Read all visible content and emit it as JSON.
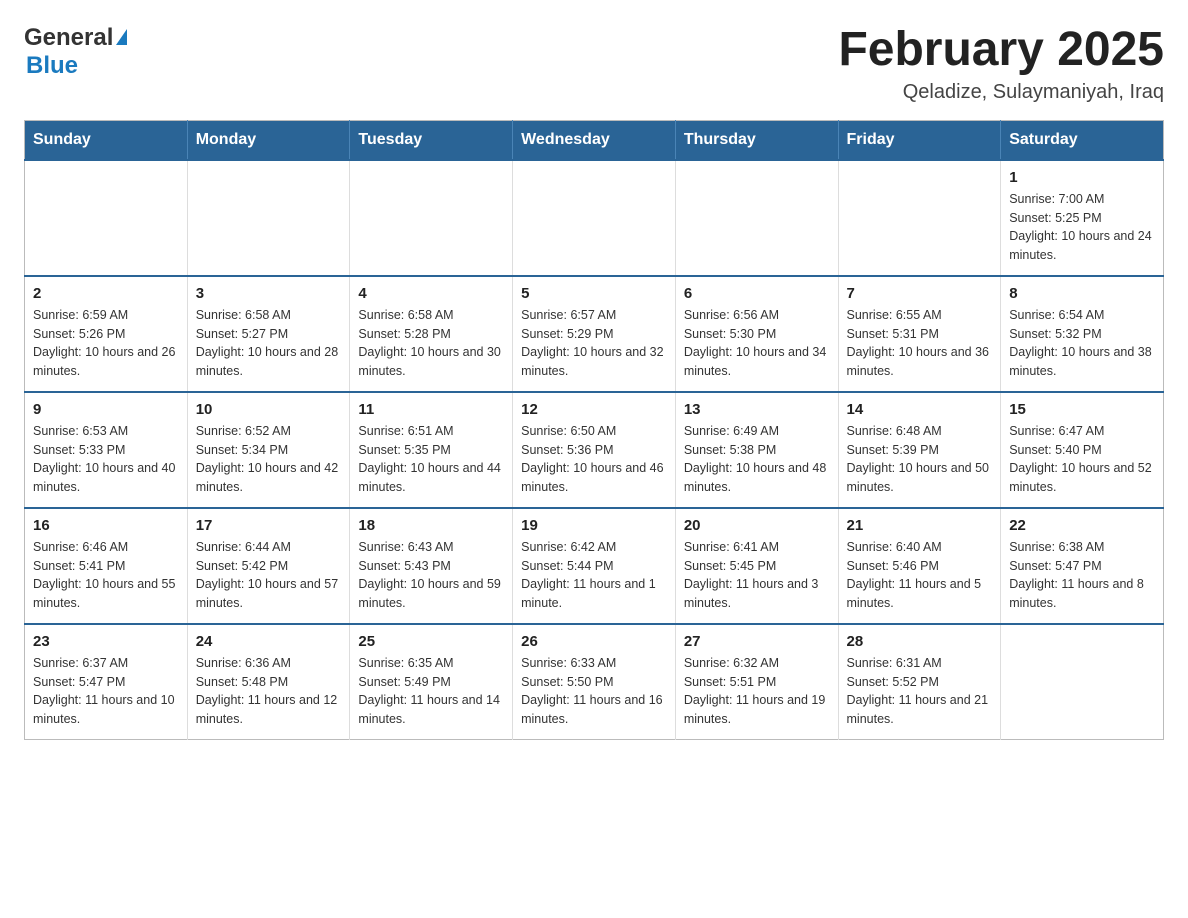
{
  "header": {
    "logo_general": "General",
    "logo_blue": "Blue",
    "title": "February 2025",
    "subtitle": "Qeladize, Sulaymaniyah, Iraq"
  },
  "days_of_week": [
    "Sunday",
    "Monday",
    "Tuesday",
    "Wednesday",
    "Thursday",
    "Friday",
    "Saturday"
  ],
  "weeks": [
    [
      {
        "day": "",
        "sunrise": "",
        "sunset": "",
        "daylight": ""
      },
      {
        "day": "",
        "sunrise": "",
        "sunset": "",
        "daylight": ""
      },
      {
        "day": "",
        "sunrise": "",
        "sunset": "",
        "daylight": ""
      },
      {
        "day": "",
        "sunrise": "",
        "sunset": "",
        "daylight": ""
      },
      {
        "day": "",
        "sunrise": "",
        "sunset": "",
        "daylight": ""
      },
      {
        "day": "",
        "sunrise": "",
        "sunset": "",
        "daylight": ""
      },
      {
        "day": "1",
        "sunrise": "Sunrise: 7:00 AM",
        "sunset": "Sunset: 5:25 PM",
        "daylight": "Daylight: 10 hours and 24 minutes."
      }
    ],
    [
      {
        "day": "2",
        "sunrise": "Sunrise: 6:59 AM",
        "sunset": "Sunset: 5:26 PM",
        "daylight": "Daylight: 10 hours and 26 minutes."
      },
      {
        "day": "3",
        "sunrise": "Sunrise: 6:58 AM",
        "sunset": "Sunset: 5:27 PM",
        "daylight": "Daylight: 10 hours and 28 minutes."
      },
      {
        "day": "4",
        "sunrise": "Sunrise: 6:58 AM",
        "sunset": "Sunset: 5:28 PM",
        "daylight": "Daylight: 10 hours and 30 minutes."
      },
      {
        "day": "5",
        "sunrise": "Sunrise: 6:57 AM",
        "sunset": "Sunset: 5:29 PM",
        "daylight": "Daylight: 10 hours and 32 minutes."
      },
      {
        "day": "6",
        "sunrise": "Sunrise: 6:56 AM",
        "sunset": "Sunset: 5:30 PM",
        "daylight": "Daylight: 10 hours and 34 minutes."
      },
      {
        "day": "7",
        "sunrise": "Sunrise: 6:55 AM",
        "sunset": "Sunset: 5:31 PM",
        "daylight": "Daylight: 10 hours and 36 minutes."
      },
      {
        "day": "8",
        "sunrise": "Sunrise: 6:54 AM",
        "sunset": "Sunset: 5:32 PM",
        "daylight": "Daylight: 10 hours and 38 minutes."
      }
    ],
    [
      {
        "day": "9",
        "sunrise": "Sunrise: 6:53 AM",
        "sunset": "Sunset: 5:33 PM",
        "daylight": "Daylight: 10 hours and 40 minutes."
      },
      {
        "day": "10",
        "sunrise": "Sunrise: 6:52 AM",
        "sunset": "Sunset: 5:34 PM",
        "daylight": "Daylight: 10 hours and 42 minutes."
      },
      {
        "day": "11",
        "sunrise": "Sunrise: 6:51 AM",
        "sunset": "Sunset: 5:35 PM",
        "daylight": "Daylight: 10 hours and 44 minutes."
      },
      {
        "day": "12",
        "sunrise": "Sunrise: 6:50 AM",
        "sunset": "Sunset: 5:36 PM",
        "daylight": "Daylight: 10 hours and 46 minutes."
      },
      {
        "day": "13",
        "sunrise": "Sunrise: 6:49 AM",
        "sunset": "Sunset: 5:38 PM",
        "daylight": "Daylight: 10 hours and 48 minutes."
      },
      {
        "day": "14",
        "sunrise": "Sunrise: 6:48 AM",
        "sunset": "Sunset: 5:39 PM",
        "daylight": "Daylight: 10 hours and 50 minutes."
      },
      {
        "day": "15",
        "sunrise": "Sunrise: 6:47 AM",
        "sunset": "Sunset: 5:40 PM",
        "daylight": "Daylight: 10 hours and 52 minutes."
      }
    ],
    [
      {
        "day": "16",
        "sunrise": "Sunrise: 6:46 AM",
        "sunset": "Sunset: 5:41 PM",
        "daylight": "Daylight: 10 hours and 55 minutes."
      },
      {
        "day": "17",
        "sunrise": "Sunrise: 6:44 AM",
        "sunset": "Sunset: 5:42 PM",
        "daylight": "Daylight: 10 hours and 57 minutes."
      },
      {
        "day": "18",
        "sunrise": "Sunrise: 6:43 AM",
        "sunset": "Sunset: 5:43 PM",
        "daylight": "Daylight: 10 hours and 59 minutes."
      },
      {
        "day": "19",
        "sunrise": "Sunrise: 6:42 AM",
        "sunset": "Sunset: 5:44 PM",
        "daylight": "Daylight: 11 hours and 1 minute."
      },
      {
        "day": "20",
        "sunrise": "Sunrise: 6:41 AM",
        "sunset": "Sunset: 5:45 PM",
        "daylight": "Daylight: 11 hours and 3 minutes."
      },
      {
        "day": "21",
        "sunrise": "Sunrise: 6:40 AM",
        "sunset": "Sunset: 5:46 PM",
        "daylight": "Daylight: 11 hours and 5 minutes."
      },
      {
        "day": "22",
        "sunrise": "Sunrise: 6:38 AM",
        "sunset": "Sunset: 5:47 PM",
        "daylight": "Daylight: 11 hours and 8 minutes."
      }
    ],
    [
      {
        "day": "23",
        "sunrise": "Sunrise: 6:37 AM",
        "sunset": "Sunset: 5:47 PM",
        "daylight": "Daylight: 11 hours and 10 minutes."
      },
      {
        "day": "24",
        "sunrise": "Sunrise: 6:36 AM",
        "sunset": "Sunset: 5:48 PM",
        "daylight": "Daylight: 11 hours and 12 minutes."
      },
      {
        "day": "25",
        "sunrise": "Sunrise: 6:35 AM",
        "sunset": "Sunset: 5:49 PM",
        "daylight": "Daylight: 11 hours and 14 minutes."
      },
      {
        "day": "26",
        "sunrise": "Sunrise: 6:33 AM",
        "sunset": "Sunset: 5:50 PM",
        "daylight": "Daylight: 11 hours and 16 minutes."
      },
      {
        "day": "27",
        "sunrise": "Sunrise: 6:32 AM",
        "sunset": "Sunset: 5:51 PM",
        "daylight": "Daylight: 11 hours and 19 minutes."
      },
      {
        "day": "28",
        "sunrise": "Sunrise: 6:31 AM",
        "sunset": "Sunset: 5:52 PM",
        "daylight": "Daylight: 11 hours and 21 minutes."
      },
      {
        "day": "",
        "sunrise": "",
        "sunset": "",
        "daylight": ""
      }
    ]
  ]
}
